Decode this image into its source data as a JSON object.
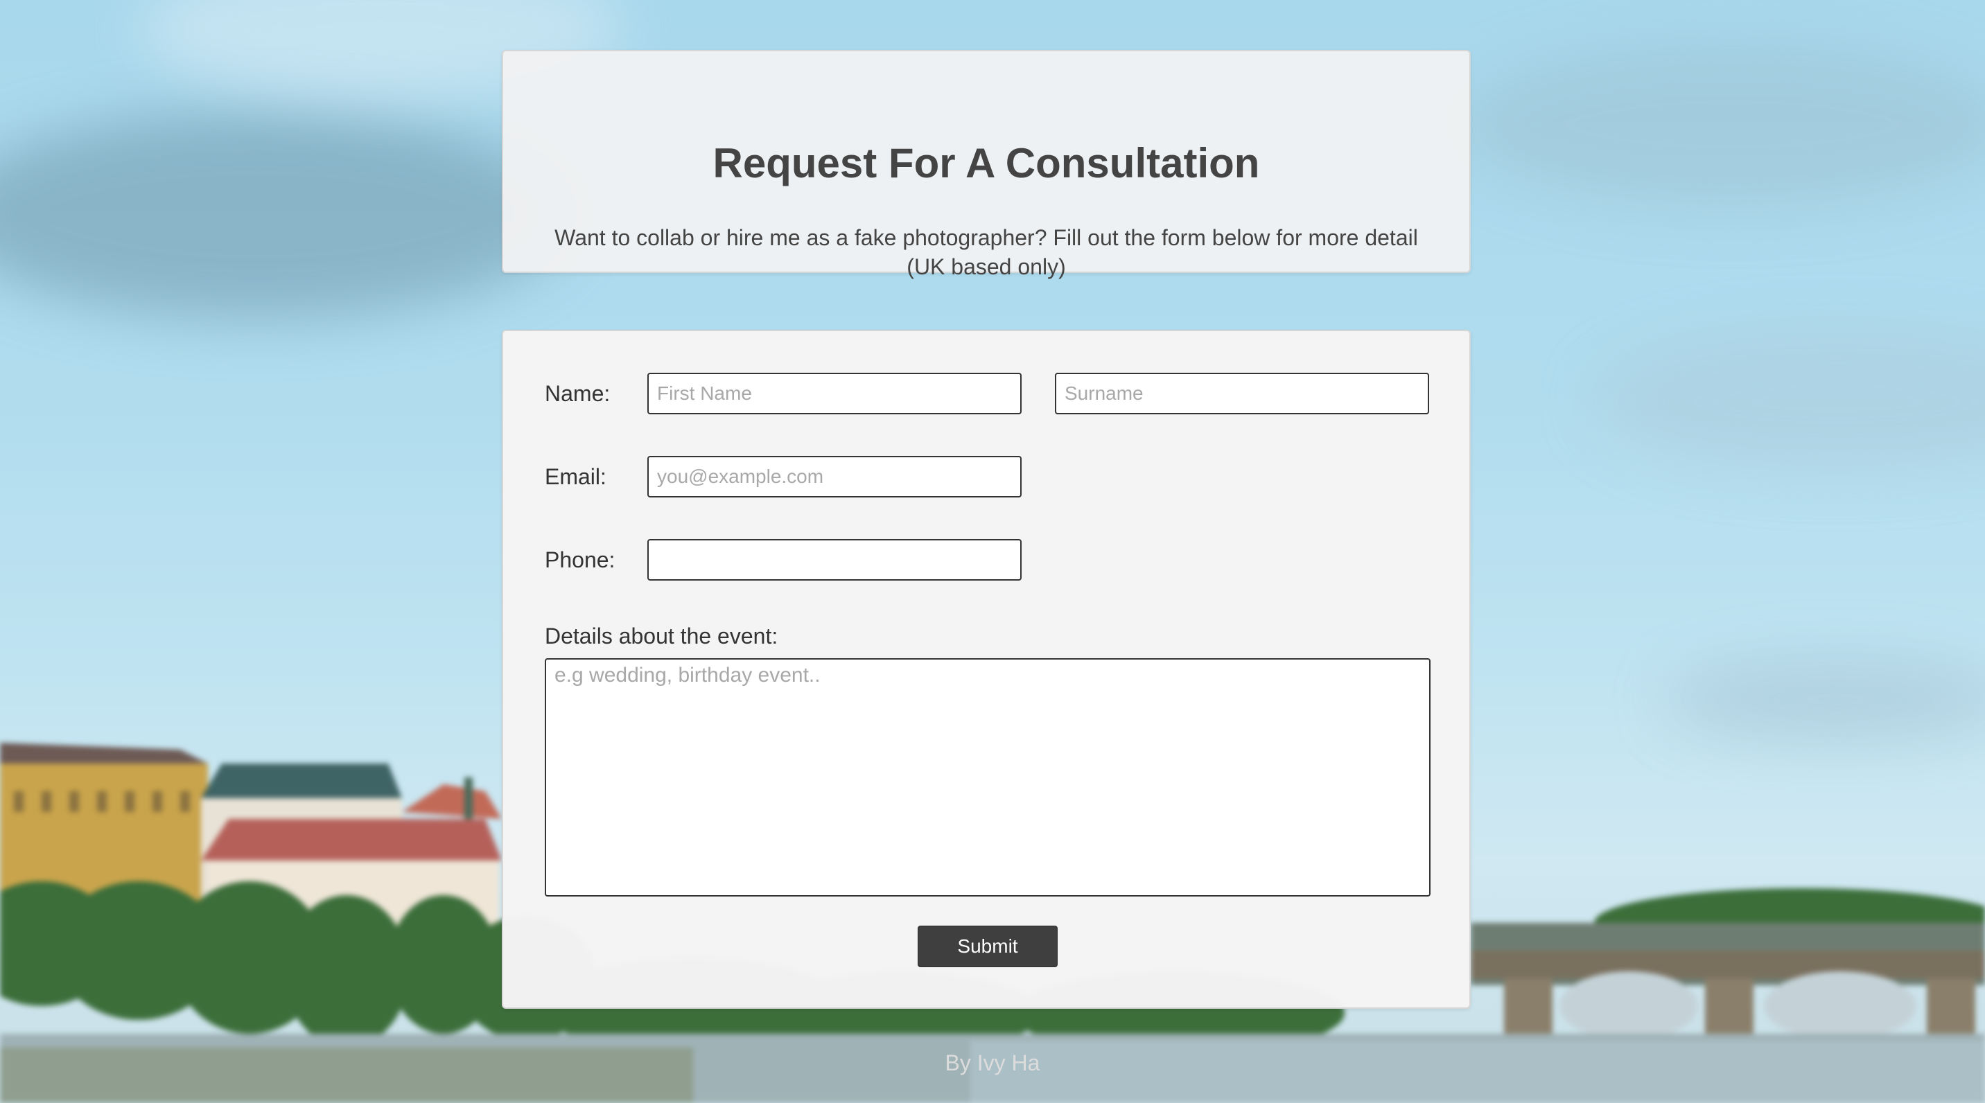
{
  "header": {
    "title": "Request For A Consultation",
    "description": "Want to collab or hire me as a fake photographer? Fill out the form below for more detail (UK based only)"
  },
  "form": {
    "name_label": "Name:",
    "first_name_placeholder": "First Name",
    "surname_placeholder": "Surname",
    "email_label": "Email:",
    "email_placeholder": "you@example.com",
    "phone_label": "Phone:",
    "phone_placeholder": "",
    "details_label": "Details about the event:",
    "details_placeholder": "e.g wedding, birthday event..",
    "submit_label": "Submit"
  },
  "footer": {
    "credit": "By Ivy Ha"
  },
  "colors": {
    "card_background": "#f5f4f5",
    "header_card_background": "#eef0f2",
    "title_text": "#444444",
    "button_background": "#3f3f3f",
    "button_text": "#ffffff",
    "footer_text": "#d9d9d9"
  }
}
